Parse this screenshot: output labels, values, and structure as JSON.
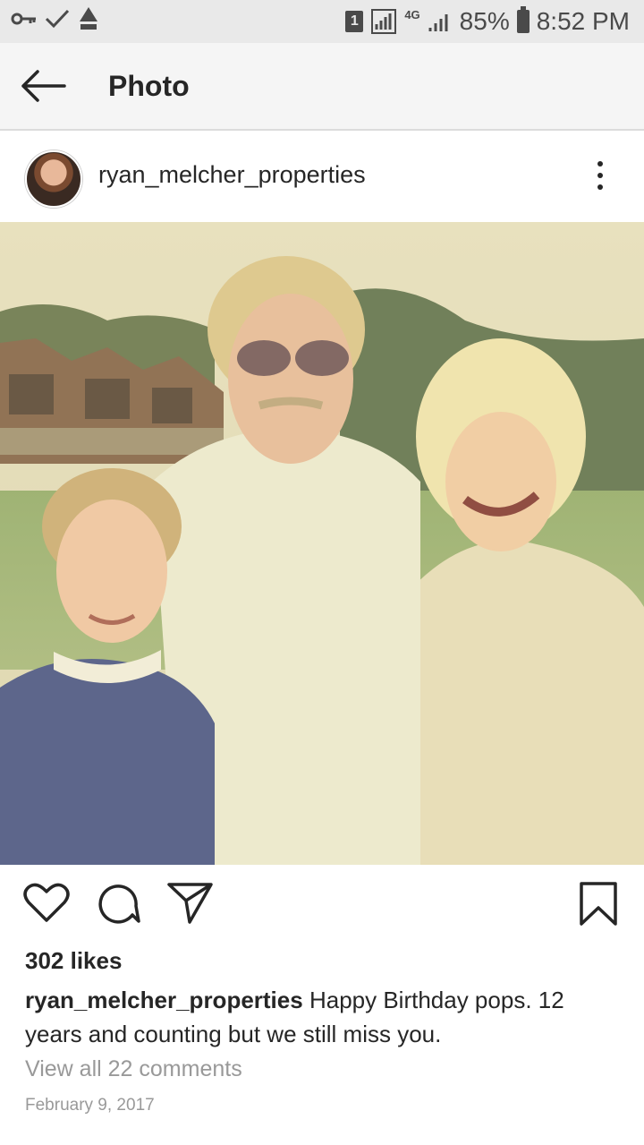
{
  "status_bar": {
    "sim_label": "1",
    "network": "4G",
    "battery": "85%",
    "time": "8:52 PM"
  },
  "nav": {
    "title": "Photo"
  },
  "post": {
    "username": "ryan_melcher_properties",
    "likes": "302 likes",
    "caption_user": "ryan_melcher_properties",
    "caption_text": "Happy Birthday pops. 12 years and counting but we still miss you.",
    "view_comments": "View all 22 comments",
    "date": "February 9, 2017"
  },
  "icons": {
    "back": "arrow-left-icon",
    "more": "more-vertical-icon",
    "like": "heart-icon",
    "comment": "comment-icon",
    "share": "share-icon",
    "save": "bookmark-icon"
  },
  "colors": {
    "text": "#262626",
    "muted": "#999999",
    "status_bar": "#e9e9e9",
    "nav_bg": "#f5f5f5"
  }
}
